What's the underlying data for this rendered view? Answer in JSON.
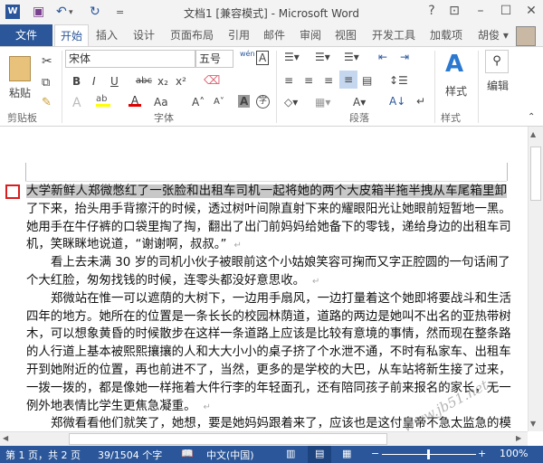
{
  "window": {
    "title": "文档1 [兼容模式] - Microsoft Word",
    "help": "?",
    "restore_ribbon": "⊡",
    "minimize": "–",
    "maximize": "☐",
    "close": "✕"
  },
  "quick_access": {
    "app_icon": "W",
    "save": "💾",
    "undo": "↶",
    "undo_drop": "▾",
    "redo": "↻",
    "customize": "="
  },
  "tabs": [
    "文件",
    "开始",
    "插入",
    "设计",
    "页面布局",
    "引用",
    "邮件",
    "审阅",
    "视图",
    "开发工具",
    "加载项"
  ],
  "user": {
    "name": "胡俊 ▾"
  },
  "ribbon": {
    "clipboard": {
      "paste": "粘贴",
      "group": "剪贴板"
    },
    "font": {
      "name": "宋体",
      "size": "五号",
      "group": "字体",
      "bold": "B",
      "italic": "I",
      "underline": "U",
      "strike": "abc",
      "sub": "x₂",
      "sup": "x²",
      "change_case": "Aa",
      "grow": "A˄",
      "shrink": "A˅",
      "phonetic": "wén",
      "border_char": "A",
      "shade_char": "A",
      "enclose": "字"
    },
    "paragraph": {
      "group": "段落"
    },
    "styles": {
      "label": "样式",
      "group": "样式"
    },
    "editing": {
      "label": "编辑"
    }
  },
  "document": {
    "lines": [
      {
        "text": "大学新鲜人郑微憋红了一张脸和出租车司机一起将她的两个大皮箱半拖半拽从车尾箱里卸",
        "indent": false,
        "last": false,
        "sel": true
      },
      {
        "text": "了下来，抬头用手背擦汗的时候，透过树叶间隙直射下来的耀眼阳光让她眼前短暂地一黑。",
        "indent": false,
        "last": false
      },
      {
        "text": "她用手在牛仔裤的口袋里掏了掏，翻出了出门前妈妈给她备下的零钱，递给身边的出租车司",
        "indent": false,
        "last": false
      },
      {
        "text": "机，笑眯眯地说道，“谢谢啊，叔叔。”",
        "indent": false,
        "last": true
      },
      {
        "text": "看上去未满 30 岁的司机小伙子被眼前这个小姑娘笑容可掬而又字正腔圆的一句话闹了",
        "indent": true,
        "last": false
      },
      {
        "text": "个大红脸，匆匆找钱的时候，连零头都没好意思收。",
        "indent": false,
        "last": true
      },
      {
        "text": "郑微站在惟一可以遮荫的大树下，一边用手扇风，一边打量着这个她即将要战斗和生活",
        "indent": true,
        "last": false
      },
      {
        "text": "四年的地方。她所在的位置是一条长长的校园林荫道，道路的两边是她叫不出名的亚热带树",
        "indent": false,
        "last": false
      },
      {
        "text": "木，可以想象黄昏的时候散步在这样一条道路上应该是比较有意境的事情，然而现在整条路",
        "indent": false,
        "last": false
      },
      {
        "text": "的人行道上基本被熙熙攘攘的人和大大小小的桌子挤了个水泄不通，不时有私家车、出租车",
        "indent": false,
        "last": false
      },
      {
        "text": "开到她附近的位置，再也前进不了，当然，更多的是学校的大巴，从车站将新生接了过来，",
        "indent": false,
        "last": false
      },
      {
        "text": "一拨一拨的，都是像她一样拖着大件行李的年轻面孔，还有陪同孩子前来报名的家长，无一",
        "indent": false,
        "last": false
      },
      {
        "text": "例外地表情比学生更焦急凝重。",
        "indent": false,
        "last": true
      },
      {
        "text": "郑微看看他们就笑了，她想，要是她妈妈跟着来了，应该也是这付皇帝不急太监急的模",
        "indent": true,
        "last": false
      }
    ],
    "para_mark": "↵"
  },
  "status": {
    "page": "第 1 页，共 2 页",
    "words": "39/1504 个字",
    "language": "中文(中国)",
    "zoom": "100%",
    "zoom_percent": 100
  },
  "watermark": "www.jb51.net",
  "colors": {
    "brand": "#2b579a",
    "highlight": "#ffff00",
    "font_color": "#e00000"
  }
}
